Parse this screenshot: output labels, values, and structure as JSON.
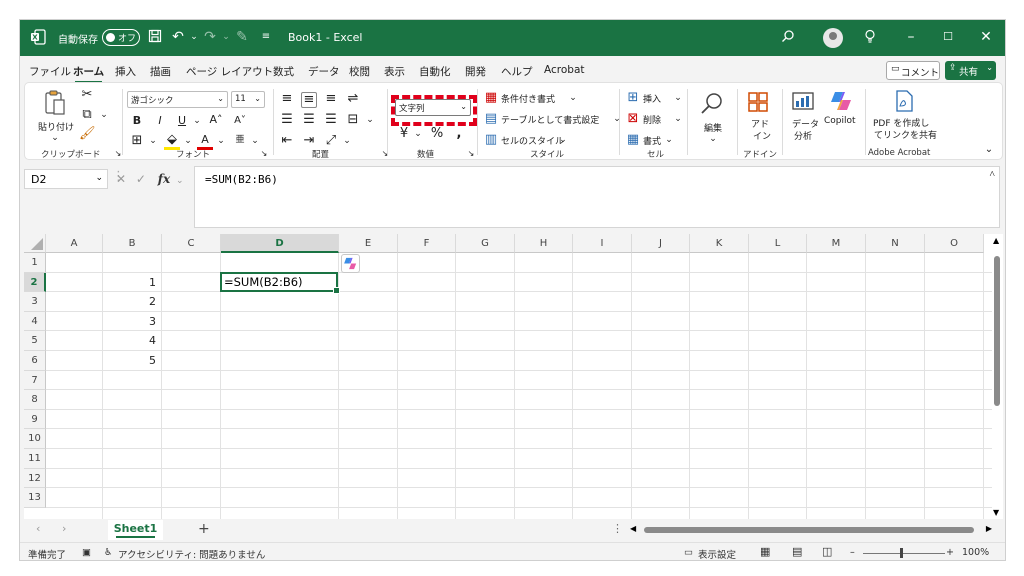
{
  "titlebar": {
    "autosave_label": "自動保存",
    "autosave_state": "オフ",
    "doc_title": "Book1  -  Excel",
    "accent": "#1a7343"
  },
  "menu": {
    "tabs": [
      "ファイル",
      "ホーム",
      "挿入",
      "描画",
      "ページ レイアウト",
      "数式",
      "データ",
      "校閲",
      "表示",
      "自動化",
      "開発",
      "ヘルプ",
      "Acrobat"
    ],
    "active": "ホーム",
    "comment_label": "コメント",
    "share_label": "共有"
  },
  "ribbon": {
    "clipboard": {
      "paste_label": "貼り付け",
      "group_label": "クリップボード"
    },
    "font": {
      "font_name": "游ゴシック",
      "font_size": "11",
      "group_label": "フォント"
    },
    "alignment": {
      "group_label": "配置"
    },
    "number": {
      "format": "文字列",
      "group_label": "数値"
    },
    "styles": {
      "conditional": "条件付き書式",
      "table": "テーブルとして書式設定",
      "cell_styles": "セルのスタイル",
      "group_label": "スタイル"
    },
    "cells": {
      "insert": "挿入",
      "delete": "削除",
      "format": "書式",
      "group_label": "セル"
    },
    "editing": {
      "label": "編集"
    },
    "addins": {
      "label_1": "アド",
      "label_2": "イン",
      "group_label": "アドイン"
    },
    "analysis": {
      "label_1": "データ",
      "label_2": "分析"
    },
    "copilot": {
      "label": "Copilot"
    },
    "acrobat": {
      "label_1": "PDF を作成し",
      "label_2": "てリンクを共有",
      "group_label": "Adobe Acrobat"
    }
  },
  "formula_bar": {
    "name_box": "D2",
    "formula": "=SUM(B2:B6)",
    "fx": "fx"
  },
  "grid": {
    "columns": [
      "A",
      "B",
      "C",
      "D",
      "E",
      "F",
      "G",
      "H",
      "I",
      "J",
      "K",
      "L",
      "M",
      "N",
      "O"
    ],
    "rows": [
      "1",
      "2",
      "3",
      "4",
      "5",
      "6",
      "7",
      "8",
      "9",
      "10",
      "11",
      "12",
      "13"
    ],
    "selected_column": "D",
    "selected_row": "2",
    "b_values": [
      "1",
      "2",
      "3",
      "4",
      "5"
    ],
    "active_cell_text": "=SUM(B2:B6)"
  },
  "sheets": {
    "active": "Sheet1"
  },
  "status": {
    "ready": "準備完了",
    "accessibility": "アクセシビリティ: 問題ありません",
    "display_settings": "表示設定",
    "zoom": "100%"
  }
}
